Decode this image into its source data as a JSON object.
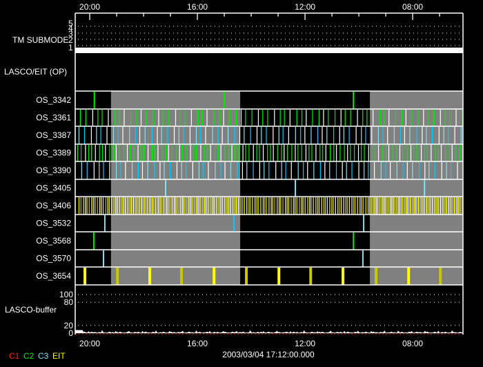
{
  "chart_data": {
    "type": "timeline",
    "title": "",
    "x_axis": {
      "unit": "hours",
      "direction": "decreasing",
      "range": [
        20.54,
        6.13
      ],
      "major_ticks": [
        20,
        16,
        12,
        8
      ],
      "tick_labels": [
        "20:00",
        "16:00",
        "12:00",
        "08:00"
      ],
      "minor_tick_step": 1
    },
    "date_label": "2003/03/04 17:12:00.000",
    "tm_submode": {
      "label": "TM SUBMODE",
      "levels": [
        "5",
        "4",
        "3",
        "2",
        "1"
      ],
      "value": 1
    },
    "lasco_eit_op": {
      "label": "LASCO/EIT (OP)"
    },
    "gray_bands": [
      [
        19.21,
        14.41
      ],
      [
        9.59,
        6.13
      ]
    ],
    "colors": {
      "C1": "#ff2020",
      "C2": "#00ee00",
      "C3": "#00ccff",
      "C3light": "#88e0f0",
      "EIT": "#ffff00",
      "EITdim": "#c8c800",
      "white": "#ffffff",
      "gray": "#808080"
    },
    "rows": [
      {
        "label": "OS_3342",
        "events": [
          [
            19.83,
            "C2"
          ],
          [
            15.0,
            "C2"
          ],
          [
            10.2,
            "C2"
          ]
        ]
      },
      {
        "label": "OS_3361",
        "cadence": {
          "start": 20.35,
          "step": 0.205,
          "colors": [
            "C2",
            "C2",
            "white"
          ]
        }
      },
      {
        "label": "OS_3387",
        "cadence": {
          "start": 20.4,
          "step": 0.205,
          "colors": [
            "C3light",
            "C3",
            "white"
          ]
        }
      },
      {
        "label": "OS_3389",
        "cadence": {
          "start": 20.45,
          "step": 0.13,
          "colors": [
            "C2",
            "C2",
            "white"
          ]
        }
      },
      {
        "label": "OS_3390",
        "cadence": {
          "start": 20.3,
          "step": 0.205,
          "colors": [
            "C3light",
            "C3",
            "white"
          ]
        }
      },
      {
        "label": "OS_3405",
        "events": [
          [
            17.18,
            "C3light"
          ],
          [
            12.36,
            "C3light"
          ],
          [
            7.56,
            "C3light"
          ]
        ]
      },
      {
        "label": "OS_3406",
        "cadence": {
          "start": 20.4,
          "step": 0.075,
          "colors": [
            "EIT",
            "EITdim",
            "EIT",
            "white"
          ]
        }
      },
      {
        "label": "OS_3532",
        "events": [
          [
            19.44,
            "C3light"
          ],
          [
            14.64,
            "C3"
          ],
          [
            9.82,
            "C3light"
          ]
        ]
      },
      {
        "label": "OS_3568",
        "events": [
          [
            19.85,
            "C2"
          ],
          [
            10.2,
            "C2"
          ]
        ]
      },
      {
        "label": "OS_3570",
        "events": [
          [
            19.49,
            "C3light"
          ],
          [
            9.85,
            "C3light"
          ]
        ]
      },
      {
        "label": "OS_3654",
        "events": [
          [
            20.18,
            "EIT"
          ],
          [
            18.97,
            "EITdim"
          ],
          [
            17.77,
            "EIT"
          ],
          [
            16.59,
            "EITdim"
          ],
          [
            15.38,
            "EIT"
          ],
          [
            14.18,
            "EITdim"
          ],
          [
            12.97,
            "EIT"
          ],
          [
            11.79,
            "EITdim"
          ],
          [
            10.59,
            "EIT"
          ],
          [
            9.36,
            "EITdim"
          ],
          [
            8.15,
            "EIT"
          ],
          [
            6.97,
            "EITdim"
          ]
        ]
      }
    ],
    "buffer": {
      "label": "LASCO-buffer",
      "ylim": [
        0,
        100
      ],
      "grid_values": [
        100,
        80,
        20
      ],
      "tick_labels": [
        "100",
        "80",
        "20",
        "0"
      ],
      "typical_level": 4,
      "peak_level": 14
    },
    "legend": [
      {
        "label": "C1",
        "color": "#ff2020"
      },
      {
        "label": "C2",
        "color": "#00ee00"
      },
      {
        "label": "C3",
        "color": "#88e0f0"
      },
      {
        "label": "EIT",
        "color": "#ffff00"
      }
    ]
  }
}
